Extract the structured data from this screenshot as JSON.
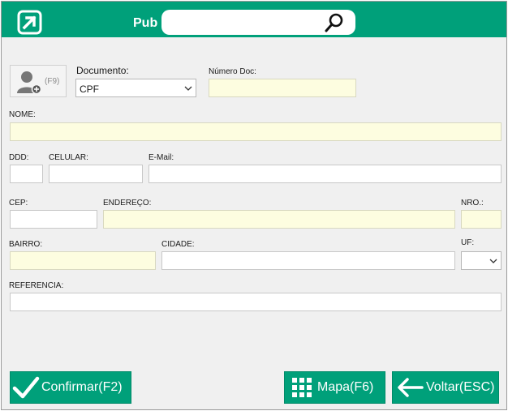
{
  "header": {
    "title": "Pub",
    "search": {
      "value": "",
      "placeholder": ""
    },
    "logo_icon": "arrow-up-right-box-icon",
    "search_icon": "magnifier-icon"
  },
  "photo": {
    "hint": "(F9)",
    "icon": "add-person-icon"
  },
  "documento": {
    "label": "Documento:",
    "selected": "CPF"
  },
  "numero_doc": {
    "label": "Número Doc:",
    "value": ""
  },
  "nome": {
    "label": "NOME:",
    "value": ""
  },
  "ddd": {
    "label": "DDD:",
    "value": ""
  },
  "celular": {
    "label": "CELULAR:",
    "value": ""
  },
  "email": {
    "label": "E-Mail:",
    "value": ""
  },
  "cep": {
    "label": "CEP:",
    "value": ""
  },
  "endereco": {
    "label": "ENDEREÇO:",
    "value": ""
  },
  "nro": {
    "label": "NRO.:",
    "value": ""
  },
  "bairro": {
    "label": "BAIRRO:",
    "value": ""
  },
  "cidade": {
    "label": "CIDADE:",
    "value": ""
  },
  "uf": {
    "label": "UF:",
    "selected": ""
  },
  "referencia": {
    "label": "REFERENCIA:",
    "value": ""
  },
  "buttons": {
    "confirmar": "Confirmar(F2)",
    "mapa": "Mapa(F6)",
    "voltar": "Voltar(ESC)"
  },
  "colors": {
    "accent": "#00a07a",
    "required_field": "#fdfde0",
    "background": "#f0f0f0"
  }
}
